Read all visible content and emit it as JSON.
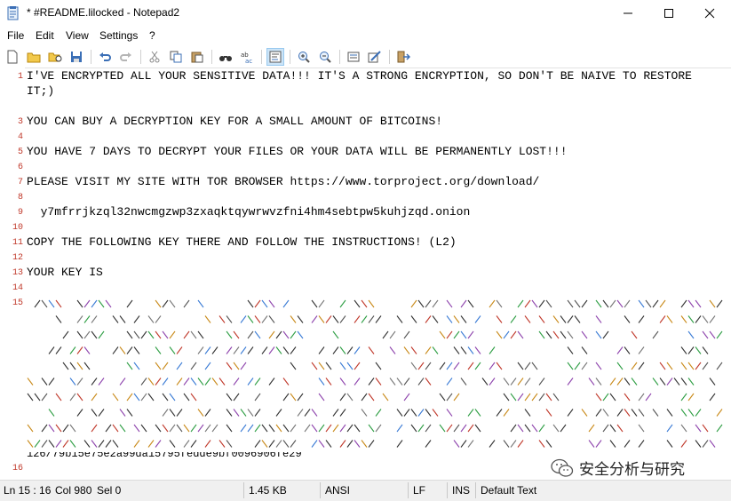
{
  "window": {
    "title": "* #README.lilocked - Notepad2"
  },
  "menu": {
    "file": "File",
    "edit": "Edit",
    "view": "View",
    "settings": "Settings",
    "help": "?"
  },
  "toolbar": {
    "icons": [
      "new-icon",
      "open-icon",
      "browse-icon",
      "save-icon",
      "undo-icon",
      "redo-icon",
      "cut-icon",
      "copy-icon",
      "paste-icon",
      "find-icon",
      "replace-icon",
      "word-wrap-icon",
      "zoom-in-icon",
      "zoom-out-icon",
      "scheme-icon",
      "customize-icon",
      "exit-icon"
    ]
  },
  "editor": {
    "line_numbers": [
      "1",
      "",
      "3",
      "4",
      "5",
      "6",
      "7",
      "8",
      "9",
      "10",
      "11",
      "12",
      "13",
      "14",
      "15",
      "16"
    ],
    "lines": [
      "I'VE ENCRYPTED ALL YOUR SENSITIVE DATA!!! IT'S A STRONG ENCRYPTION, SO DON'T BE NAIVE TO RESTORE",
      "IT;)",
      "YOU CAN BUY A DECRYPTION KEY FOR A SMALL AMOUNT OF BITCOINS!",
      "YOU HAVE 7 DAYS TO DECRYPT YOUR FILES OR YOUR DATA WILL BE PERMANENTLY LOST!!!",
      "PLEASE VISIT MY SITE WITH TOR BROWSER https://www.torproject.org/download/",
      "  y7mfrrjkzql32nwcmgzwp3zxaqktqywrwvzfni4hm4sebtpw5kuhjzqd.onion",
      "COPY THE FOLLOWING KEY THERE AND FOLLOW THE INSTRUCTIONS! (L2)",
      "YOUR KEY IS"
    ],
    "key_tail": "126/79b15e75e2a99da15795fedde9bf0096906fe29"
  },
  "watermark": {
    "text": "安全分析与研究"
  },
  "status": {
    "position": "Ln 15 : 16",
    "column": "Col 980",
    "selection": "Sel 0",
    "size": "1.45 KB",
    "encoding": "ANSI",
    "line_ending": "LF",
    "insert_mode": "INS",
    "scheme": "Default Text"
  }
}
